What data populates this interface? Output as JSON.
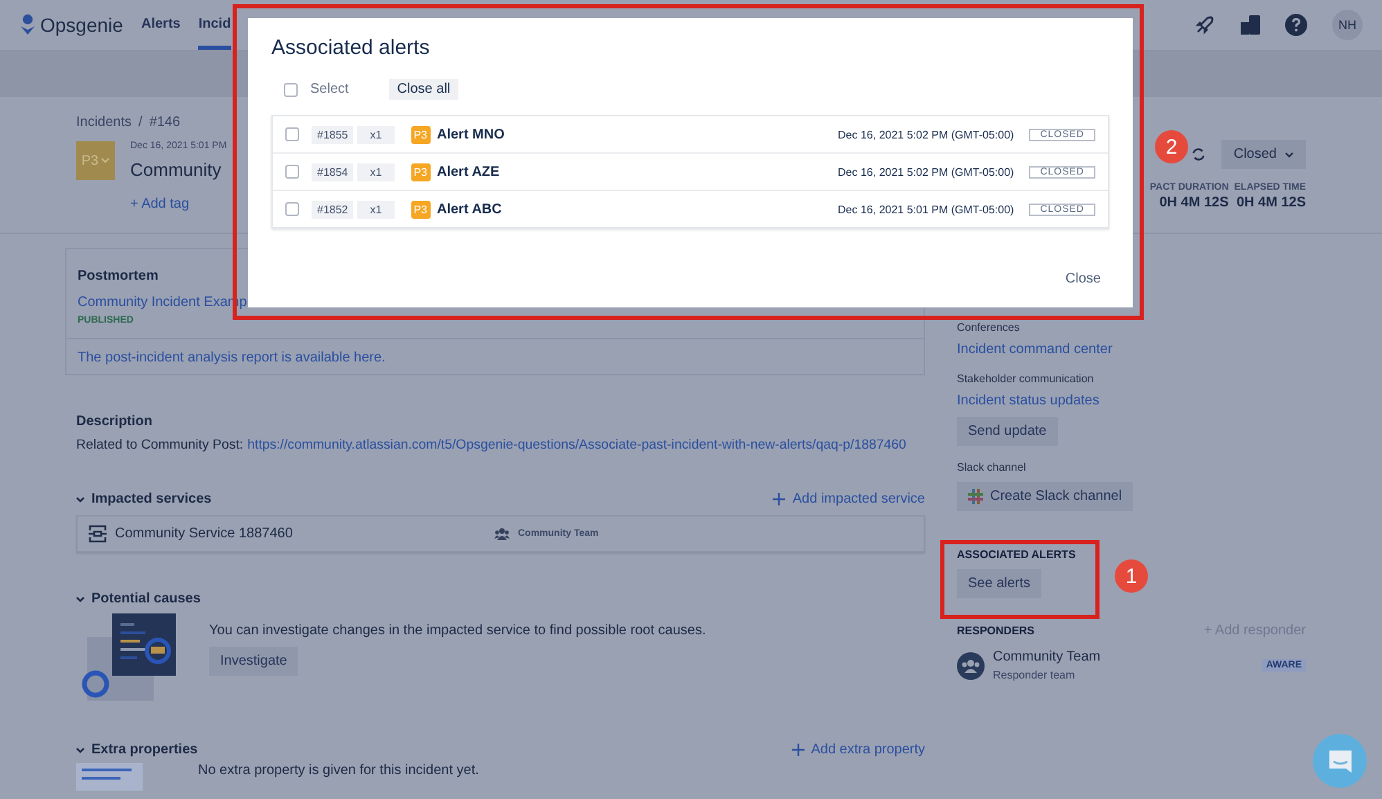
{
  "nav": {
    "logo": "Opsgenie",
    "tabs": [
      {
        "label": "Alerts",
        "selected": false
      },
      {
        "label": "Incid",
        "selected": true
      }
    ],
    "avatar": "NH"
  },
  "incident": {
    "breadcrumb": {
      "items": [
        "Incidents",
        "#146"
      ],
      "separator": "/"
    },
    "priority": "P3",
    "date": "Dec 16, 2021 5:01 PM",
    "title": "Community",
    "add_tag": "+ Add tag",
    "status": "Closed",
    "metrics": [
      {
        "label": "PACT DURATION",
        "value": "0H 4M 12S"
      },
      {
        "label": "ELAPSED TIME",
        "value": "0H 4M 12S"
      }
    ]
  },
  "postmortem": {
    "heading": "Postmortem",
    "link": "Community Incident Examp",
    "badge": "PUBLISHED",
    "note": "The post-incident analysis report is available here."
  },
  "description": {
    "heading": "Description",
    "prefix": "Related to Community Post:",
    "link": "https://community.atlassian.com/t5/Opsgenie-questions/Associate-past-incident-with-new-alerts/qaq-p/1887460"
  },
  "impacted_services": {
    "heading": "Impacted services",
    "expanded": true,
    "add": "Add impacted service",
    "services": [
      {
        "name": "Community Service 1887460",
        "team": "Community Team"
      }
    ]
  },
  "potential_causes": {
    "heading": "Potential causes",
    "expanded": true,
    "text": "You can investigate changes in the impacted service to find possible root causes.",
    "button": "Investigate"
  },
  "extra_properties": {
    "heading": "Extra properties",
    "expanded": true,
    "add": "Add extra property",
    "text": "No extra property is given for this incident yet."
  },
  "sidebar": {
    "groups": [
      {
        "label": "Conferences",
        "link": "Incident command center"
      },
      {
        "label": "Stakeholder communication",
        "link": "Incident status updates",
        "button": "Send update"
      },
      {
        "label": "Slack channel",
        "button": "Create Slack channel",
        "kind": "slack"
      }
    ],
    "associated_alerts": {
      "heading": "ASSOCIATED ALERTS",
      "button": "See alerts"
    },
    "responders": {
      "heading": "RESPONDERS",
      "add": "+ Add responder",
      "items": [
        {
          "name": "Community Team",
          "role": "Responder team",
          "status": "AWARE"
        }
      ]
    }
  },
  "modal": {
    "title": "Associated alerts",
    "select": {
      "label": "Select",
      "checked": false
    },
    "close_all": "Close all",
    "alerts": [
      {
        "id": "#1855",
        "count": "x1",
        "priority": "P3",
        "name": "Alert MNO",
        "time": "Dec 16, 2021 5:02 PM (GMT-05:00)",
        "status": "CLOSED",
        "checked": false
      },
      {
        "id": "#1854",
        "count": "x1",
        "priority": "P3",
        "name": "Alert AZE",
        "time": "Dec 16, 2021 5:02 PM (GMT-05:00)",
        "status": "CLOSED",
        "checked": false
      },
      {
        "id": "#1852",
        "count": "x1",
        "priority": "P3",
        "name": "Alert ABC",
        "time": "Dec 16, 2021 5:01 PM (GMT-05:00)",
        "status": "CLOSED",
        "checked": false
      }
    ],
    "close": "Close"
  },
  "annotations": [
    {
      "number": "1"
    },
    {
      "number": "2"
    }
  ]
}
